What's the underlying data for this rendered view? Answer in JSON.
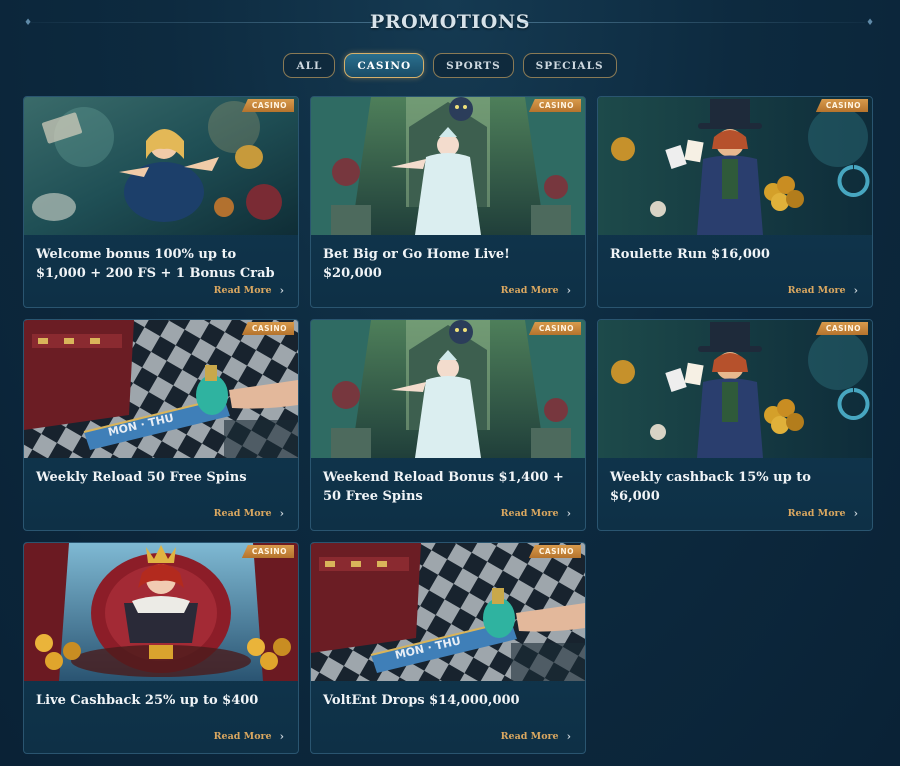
{
  "header": {
    "title": "PROMOTIONS"
  },
  "tabs": [
    {
      "label": "ALL",
      "active": false
    },
    {
      "label": "CASINO",
      "active": true
    },
    {
      "label": "SPORTS",
      "active": false
    },
    {
      "label": "SPECIALS",
      "active": false
    }
  ],
  "cards": [
    {
      "title": "Welcome bonus 100% up to $1,000 + 200 FS + 1 Bonus Crab",
      "badge": "CASINO",
      "more": "Read More",
      "scene": "alice"
    },
    {
      "title": "Bet Big or Go Home Live! $20,000",
      "badge": "CASINO",
      "more": "Read More",
      "scene": "queen-white"
    },
    {
      "title": "Roulette Run $16,000",
      "badge": "CASINO",
      "more": "Read More",
      "scene": "hatter"
    },
    {
      "title": "Weekly Reload 50 Free Spins",
      "badge": "CASINO",
      "more": "Read More",
      "scene": "potion"
    },
    {
      "title": "Weekend Reload Bonus $1,400 + 50 Free Spins",
      "badge": "CASINO",
      "more": "Read More",
      "scene": "queen-white"
    },
    {
      "title": "Weekly cashback 15% up to $6,000",
      "badge": "CASINO",
      "more": "Read More",
      "scene": "hatter"
    },
    {
      "title": "Live Cashback 25% up to $400",
      "badge": "CASINO",
      "more": "Read More",
      "scene": "queen-red"
    },
    {
      "title": "VoltEnt Drops $14,000,000",
      "badge": "CASINO",
      "more": "Read More",
      "scene": "potion"
    }
  ],
  "icons": {
    "read_more": "chevron-right-icon"
  }
}
